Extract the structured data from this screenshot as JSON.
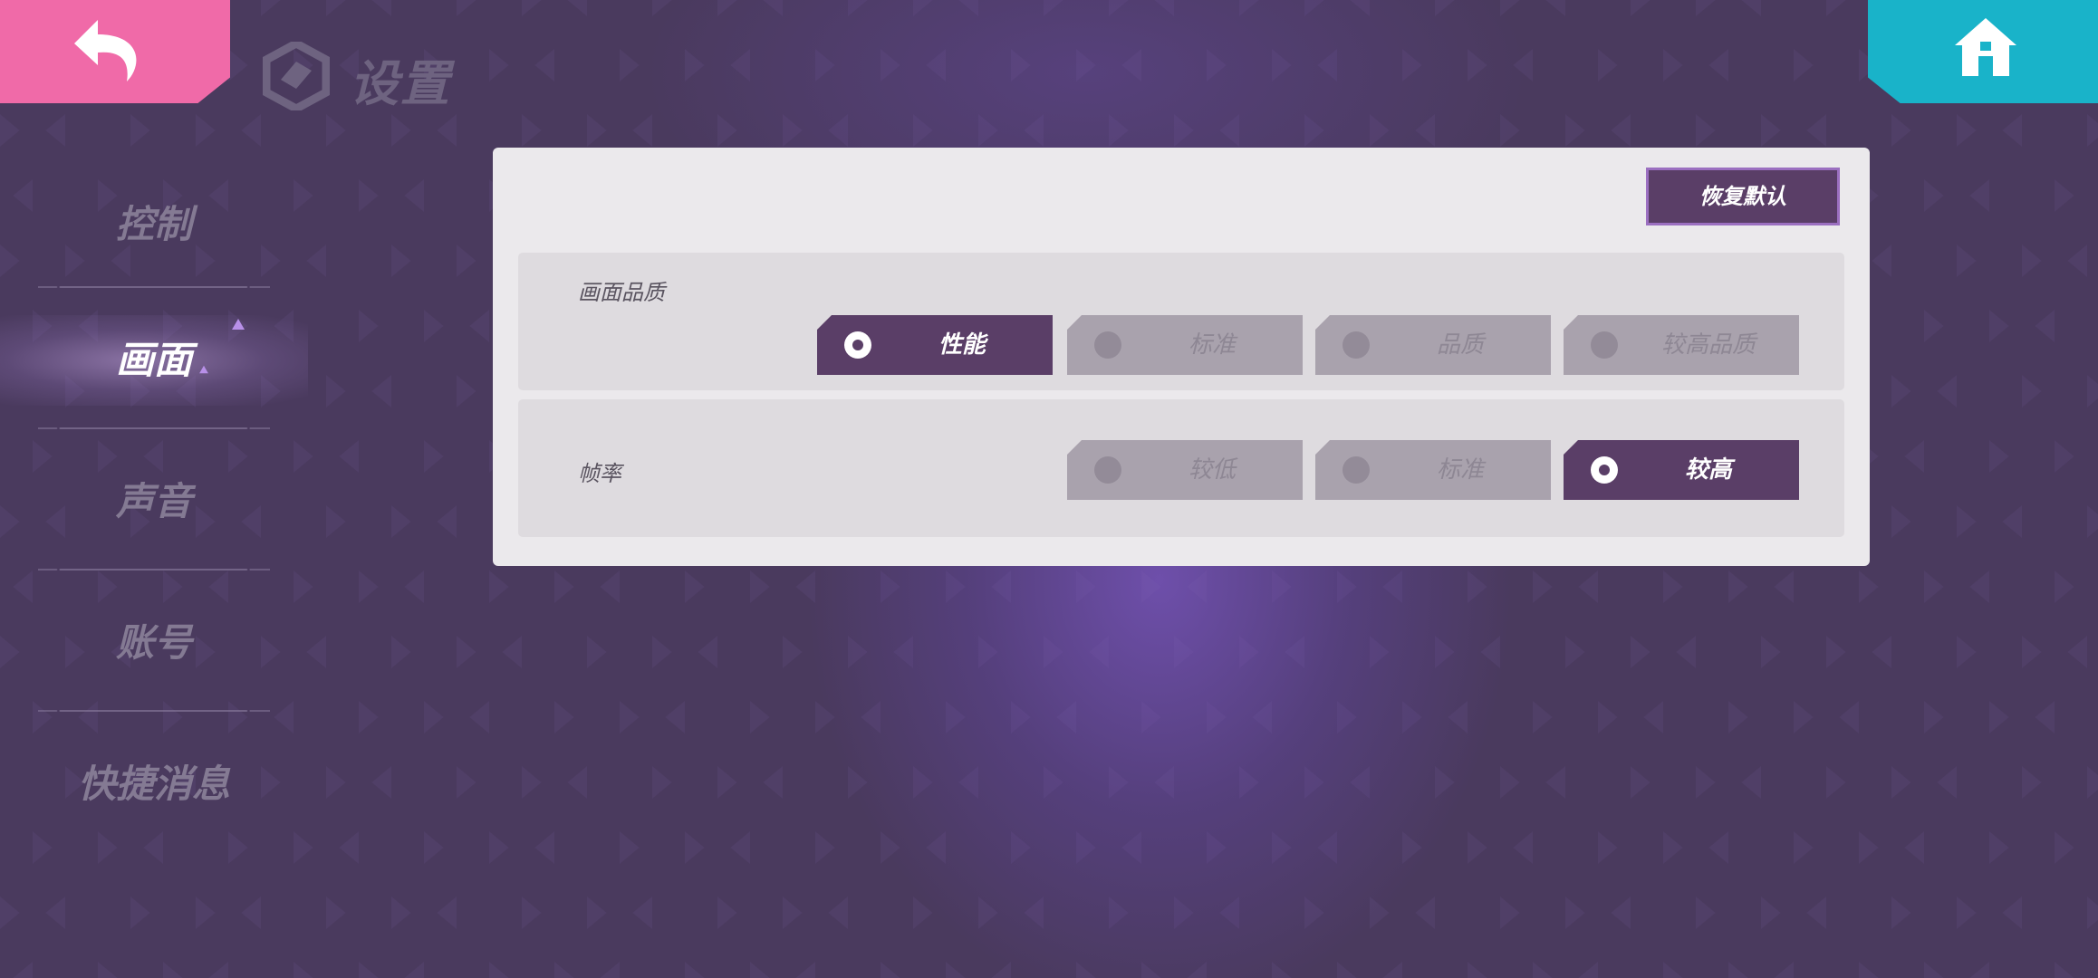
{
  "header": {
    "title": "设置",
    "back_icon": "undo-arrow-icon",
    "home_icon": "home-icon"
  },
  "sidebar": {
    "items": [
      {
        "label": "控制",
        "active": false
      },
      {
        "label": "画面",
        "active": true
      },
      {
        "label": "声音",
        "active": false
      },
      {
        "label": "账号",
        "active": false
      },
      {
        "label": "快捷消息",
        "active": false
      }
    ]
  },
  "panel": {
    "reset_label": "恢复默认",
    "quality": {
      "label": "画面品质",
      "options": [
        {
          "label": "性能",
          "selected": true
        },
        {
          "label": "标准",
          "selected": false
        },
        {
          "label": "品质",
          "selected": false
        },
        {
          "label": "较高品质",
          "selected": false
        }
      ]
    },
    "framerate": {
      "label": "帧率",
      "options": [
        {
          "label": "较低",
          "selected": false
        },
        {
          "label": "标准",
          "selected": false
        },
        {
          "label": "较高",
          "selected": true
        }
      ]
    }
  },
  "colors": {
    "background": "#4a3a5e",
    "back_button": "#f06aa8",
    "home_button": "#19b3c9",
    "selected_option": "#5a3e67",
    "unselected_option": "#a9a2ad",
    "panel": "#ebe9ec"
  }
}
